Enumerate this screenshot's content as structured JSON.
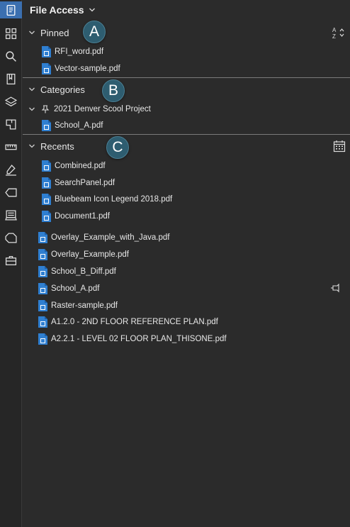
{
  "panel": {
    "title": "File Access"
  },
  "sections": {
    "pinned": {
      "label": "Pinned",
      "callout": "A",
      "items": [
        "RFI_word.pdf",
        "Vector-sample.pdf"
      ]
    },
    "categories": {
      "label": "Categories",
      "callout": "B",
      "subcategory": "2021 Denver Scool Project",
      "items": [
        "School_A.pdf"
      ]
    },
    "recents": {
      "label": "Recents",
      "callout": "C",
      "items_indented": [
        "Combined.pdf",
        "SearchPanel.pdf",
        "Bluebeam Icon Legend 2018.pdf",
        "Document1.pdf"
      ],
      "items": [
        "Overlay_Example_with_Java.pdf",
        "Overlay_Example.pdf",
        "School_B_Diff.pdf",
        "School_A.pdf",
        "Raster-sample.pdf",
        "A1.2.0 - 2ND FLOOR REFERENCE PLAN.pdf",
        "A2.2.1 - LEVEL 02 FLOOR PLAN_THISONE.pdf"
      ]
    }
  },
  "icons": {
    "rail": [
      "file-access-icon",
      "thumbnails-icon",
      "search-icon",
      "bookmarks-icon",
      "layers-icon",
      "spaces-icon",
      "measurements-icon",
      "signatures-icon",
      "tags-icon",
      "studio-icon",
      "properties-icon",
      "toolchest-icon"
    ],
    "sort": "sort-alpha-icon",
    "calendar": "calendar-icon",
    "pin": "pin-icon"
  },
  "colors": {
    "accent": "#3b6fb0",
    "pdf_icon": "#2f7fd1",
    "callout": "#2e5d70",
    "background": "#2b2b2b"
  }
}
